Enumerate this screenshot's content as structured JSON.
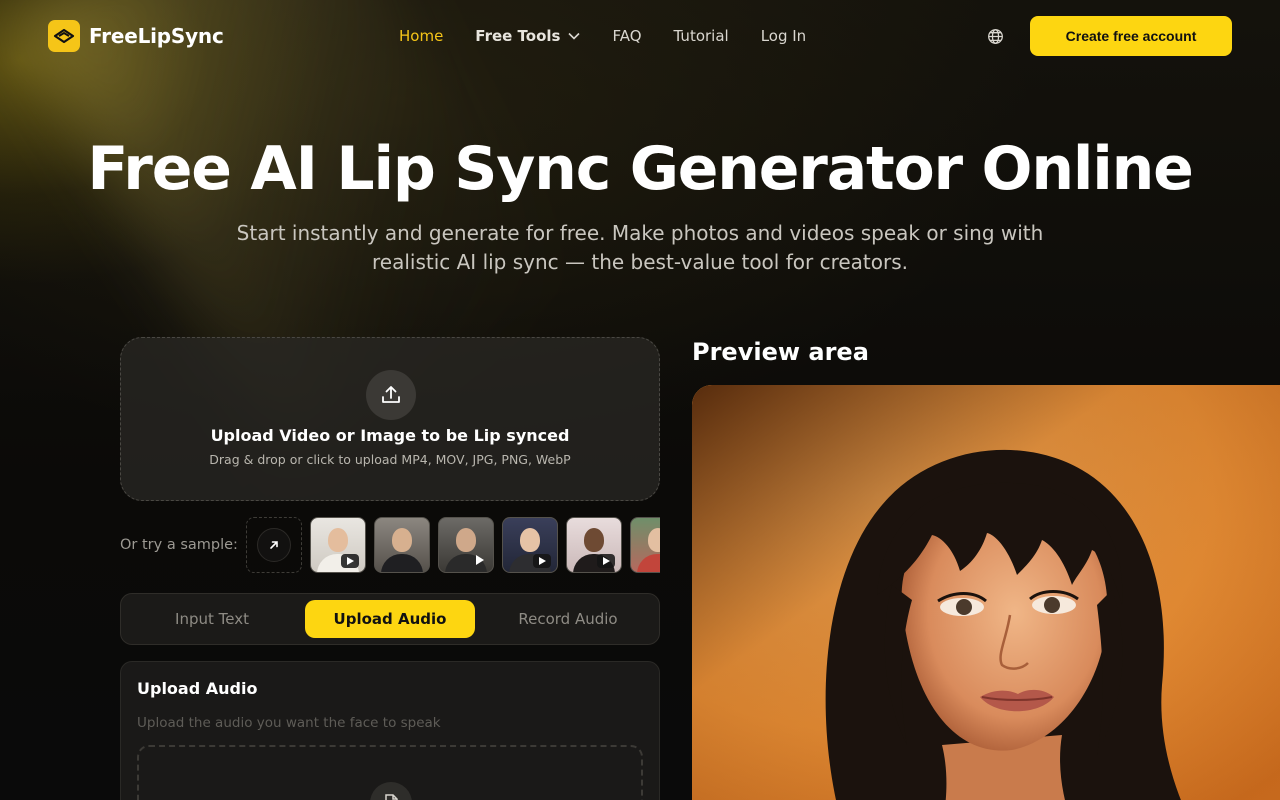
{
  "brand": {
    "name": "FreeLipSync",
    "accent": "#fdd611"
  },
  "nav": {
    "items": [
      {
        "label": "Home",
        "active": true
      },
      {
        "label": "Free Tools",
        "has_dropdown": true
      },
      {
        "label": "FAQ"
      },
      {
        "label": "Tutorial"
      },
      {
        "label": "Log In"
      }
    ],
    "language_icon": "globe-icon",
    "cta_label": "Create free account"
  },
  "hero": {
    "title": "Free AI Lip Sync Generator Online",
    "subtitle": "Start instantly and generate for free. Make photos and videos speak or sing with realistic AI lip sync — the best-value tool for creators."
  },
  "upload": {
    "icon": "upload-icon",
    "title": "Upload Video or Image to be Lip synced",
    "hint": "Drag & drop or click to upload MP4, MOV, JPG, PNG, WebP"
  },
  "samples": {
    "label": "Or try a sample:",
    "more_icon": "arrow-up-right-icon",
    "items": [
      {
        "kind": "video"
      },
      {
        "kind": "image"
      },
      {
        "kind": "image"
      },
      {
        "kind": "video"
      },
      {
        "kind": "video"
      },
      {
        "kind": "video"
      }
    ]
  },
  "audio_tabs": {
    "items": [
      {
        "label": "Input Text",
        "active": false
      },
      {
        "label": "Upload Audio",
        "active": true
      },
      {
        "label": "Record Audio",
        "active": false
      }
    ]
  },
  "audio_panel": {
    "title": "Upload Audio",
    "hint": "Upload the audio you want the face to speak",
    "drop_icon": "file-audio-icon"
  },
  "preview": {
    "label": "Preview area"
  }
}
